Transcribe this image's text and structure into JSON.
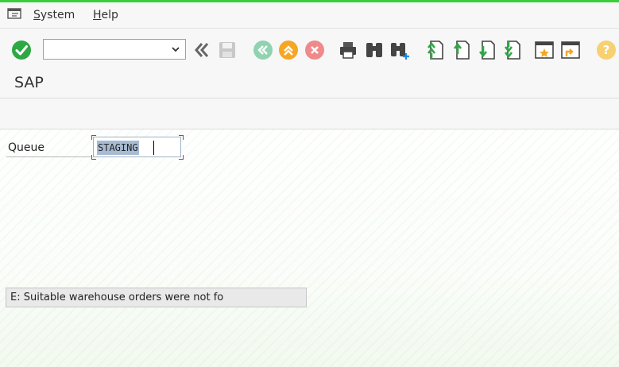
{
  "menubar": {
    "items": [
      {
        "label": "System",
        "key": "S",
        "rest": "ystem"
      },
      {
        "label": "Help",
        "key": "H",
        "rest": "elp"
      }
    ]
  },
  "toolbar": {
    "command_field_value": "",
    "icons": [
      "enter-icon",
      "back-icon",
      "save-icon",
      "first-page-icon",
      "exit-icon",
      "cancel-icon",
      "print-icon",
      "find-icon",
      "find-next-icon",
      "first-page-nav-icon",
      "previous-page-icon",
      "next-page-icon",
      "last-page-icon",
      "create-session-icon",
      "shortcut-icon",
      "help-icon"
    ]
  },
  "title": "SAP",
  "form": {
    "queue_label": "Queue",
    "queue_value": "STAGING"
  },
  "status_bar": {
    "message": "E: Suitable warehouse orders were not fo"
  },
  "colors": {
    "accent_green": "#3ccd3c",
    "enter_green": "#2ea843",
    "nav_orange": "#f5a623",
    "cancel_red": "#e34040",
    "selection": "#a7bcd3"
  }
}
